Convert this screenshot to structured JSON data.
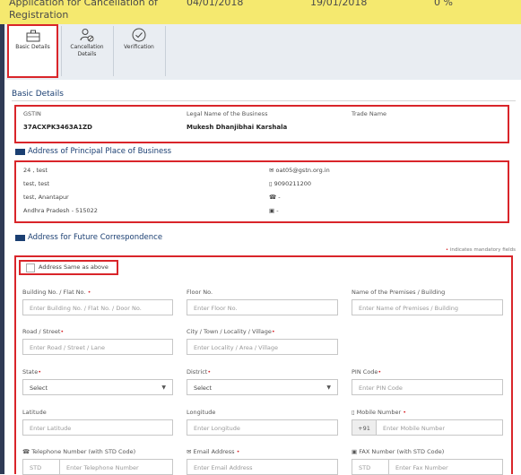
{
  "topbar": {
    "application_line1": "Application for Cancellation of",
    "application_line2": "Registration",
    "date_1": "04/01/2018",
    "date_2": "19/01/2018",
    "percent": "0 %"
  },
  "tabs": [
    {
      "label": "Basic Details",
      "active": true,
      "icon": "briefcase-icon"
    },
    {
      "label": "Cancellation Details",
      "active": false,
      "icon": "user-cancel-icon"
    },
    {
      "label": "Verification",
      "active": false,
      "icon": "check-circle-icon"
    }
  ],
  "basic_details": {
    "heading": "Basic Details",
    "gstin_label": "GSTIN",
    "gstin_value": "37ACXPK3463A1ZD",
    "legal_name_label": "Legal Name of the Business",
    "legal_name_value": "Mukesh Dhanjibhai Karshala",
    "trade_name_label": "Trade Name"
  },
  "principal_place": {
    "heading": "Address of Principal Place of Business",
    "address_lines": [
      "24 , test",
      "test, test",
      "test, Anantapur",
      "Andhra Pradesh - 515022"
    ],
    "email": "oat05@gstn.org.in",
    "mobile": "9090211200",
    "phone": "-",
    "fax": "-"
  },
  "future_correspondence": {
    "heading": "Address for Future Correspondence",
    "mandatory_note": "indicates mandatory fields",
    "same_as_above_label": "Address Same as above",
    "fields": {
      "building": {
        "label": "Building No. / Flat No.",
        "required": true,
        "placeholder": "Enter Building No. / Flat No. / Door No."
      },
      "floor": {
        "label": "Floor No.",
        "required": false,
        "placeholder": "Enter Floor No."
      },
      "premises": {
        "label": "Name of the Premises / Building",
        "required": false,
        "placeholder": "Enter Name of Premises / Building"
      },
      "road": {
        "label": "Road / Street",
        "required": true,
        "placeholder": "Enter Road / Street / Lane"
      },
      "city": {
        "label": "City / Town / Locality / Village",
        "required": true,
        "placeholder": "Enter Locality / Area / Village"
      },
      "state": {
        "label": "State",
        "required": true,
        "selected": "Select"
      },
      "district": {
        "label": "District",
        "required": true,
        "selected": "Select"
      },
      "pin": {
        "label": "PIN Code",
        "required": true,
        "placeholder": "Enter PIN Code"
      },
      "latitude": {
        "label": "Latitude",
        "required": false,
        "placeholder": "Enter Latitude"
      },
      "longitude": {
        "label": "Longitude",
        "required": false,
        "placeholder": "Enter Longitude"
      },
      "mobile": {
        "label": "Mobile Number",
        "required": true,
        "prefix": "+91",
        "placeholder": "Enter Mobile Number"
      },
      "telephone": {
        "label": "Telephone Number (with STD Code)",
        "std_placeholder": "STD",
        "placeholder": "Enter Telephone Number"
      },
      "email": {
        "label": "Email Address",
        "required": true,
        "placeholder": "Enter Email Address"
      },
      "fax": {
        "label": "FAX Number (with STD Code)",
        "std_placeholder": "STD",
        "placeholder": "Enter Fax Number"
      }
    }
  },
  "required_marker": "•",
  "colors": {
    "accent_red": "#d9252a",
    "heading_blue": "#1b3f72",
    "topbar_yellow": "#f5e96f"
  }
}
